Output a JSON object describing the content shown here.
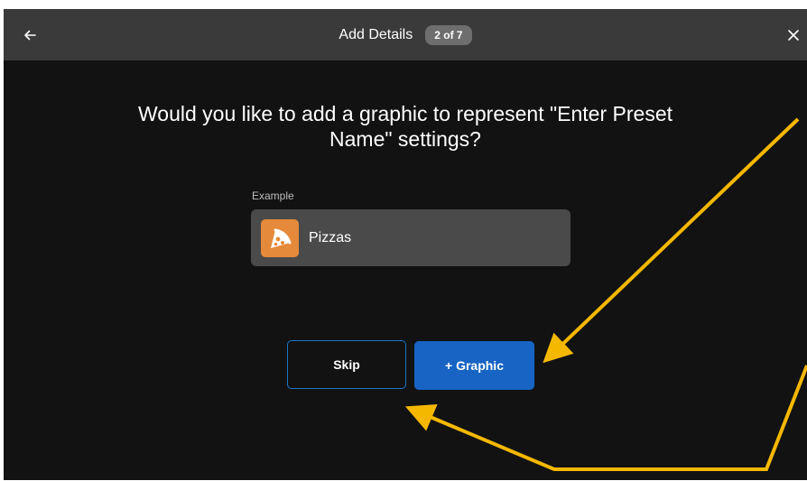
{
  "header": {
    "title": "Add Details",
    "step_badge": "2 of 7",
    "back_icon": "arrow-left-icon",
    "close_icon": "close-icon"
  },
  "main": {
    "question": "Would you like to add a graphic to represent \"Enter Preset Name\" settings?",
    "example_label": "Example",
    "example_item": {
      "icon": "pizza-slice-icon",
      "name": "Pizzas"
    }
  },
  "actions": {
    "skip_label": "Skip",
    "graphic_label": "+ Graphic"
  },
  "colors": {
    "background": "#121212",
    "topbar": "#3a3a3a",
    "card": "#4a4a4a",
    "accent": "#1764c4",
    "icon_bg": "#e58a3a",
    "annotation_arrow": "#f5b800"
  }
}
